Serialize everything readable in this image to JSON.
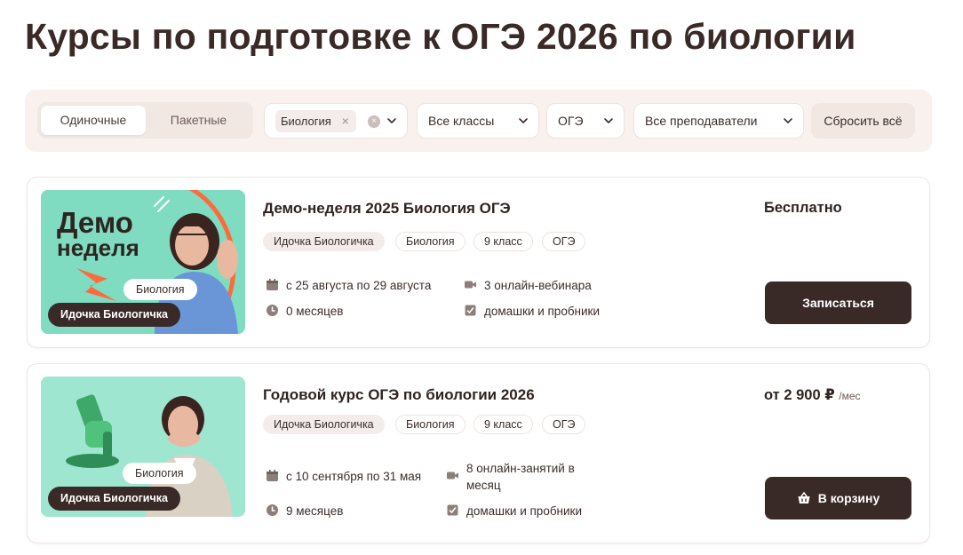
{
  "page_title": "Курсы по подготовке к ОГЭ 2026 по биологии",
  "filters": {
    "segment": {
      "active": "Одиночные",
      "inactive": "Пакетные"
    },
    "subject_chip": "Биология",
    "grade": "Все классы",
    "exam": "ОГЭ",
    "teacher": "Все преподаватели",
    "reset": "Сбросить всё"
  },
  "courses": [
    {
      "thumb_title_1": "Демо",
      "thumb_title_2": "неделя",
      "thumb_subject": "Биология",
      "thumb_teacher": "Идочка Биологичка",
      "title": "Демо-неделя 2025 Биология ОГЭ",
      "tags": [
        "Идочка Биологичка",
        "Биология",
        "9 класс",
        "ОГЭ"
      ],
      "dates": "с 25 августа по 29 августа",
      "duration": "0 месяцев",
      "lessons": "3 онлайн-вебинара",
      "homework": "домашки и пробники",
      "price": "Бесплатно",
      "price_unit": "",
      "cta": "Записаться",
      "cta_icon": ""
    },
    {
      "thumb_subject": "Биология",
      "thumb_teacher": "Идочка Биологичка",
      "title": "Годовой курс ОГЭ по биологии 2026",
      "tags": [
        "Идочка Биологичка",
        "Биология",
        "9 класс",
        "ОГЭ"
      ],
      "dates": "с 10 сентября по 31 мая",
      "duration": "9 месяцев",
      "lessons_line1": "8 онлайн-занятий в",
      "lessons_line2": "месяц",
      "homework": "домашки и пробники",
      "price": "от 2 900 ₽",
      "price_unit": "/мес",
      "cta": "В корзину",
      "cta_icon": "basket-icon"
    }
  ],
  "colors": {
    "dark": "#3a2a27",
    "filter_bg": "#f8f1ee",
    "mint": "#7fdcc0",
    "accent_orange": "#ff6a3d"
  }
}
